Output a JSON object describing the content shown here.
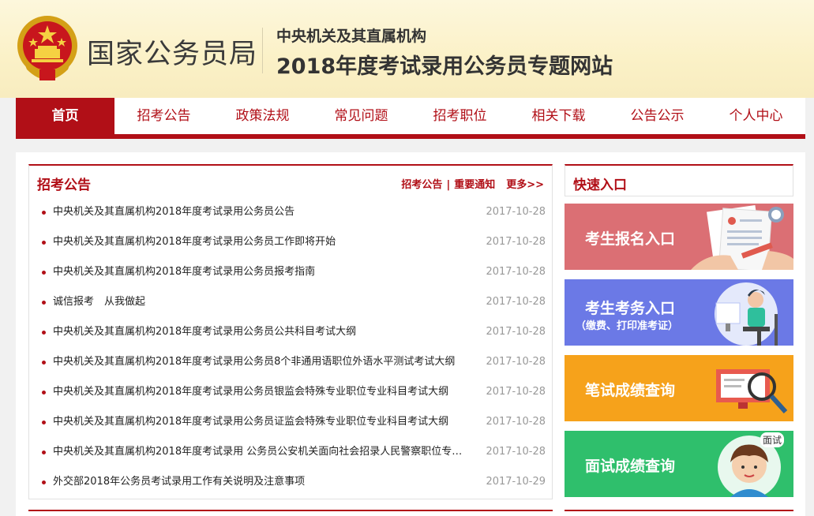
{
  "header": {
    "org_name": "国家公务员局",
    "subtitle_line1": "中央机关及其直属机构",
    "subtitle_line2": "2018年度考试录用公务员专题网站",
    "emblem_icon": "national-emblem-icon"
  },
  "nav": {
    "items": [
      {
        "label": "首页",
        "active": true
      },
      {
        "label": "招考公告"
      },
      {
        "label": "政策法规"
      },
      {
        "label": "常见问题"
      },
      {
        "label": "招考职位"
      },
      {
        "label": "相关下载"
      },
      {
        "label": "公告公示"
      },
      {
        "label": "个人中心"
      }
    ]
  },
  "notices": {
    "title": "招考公告",
    "link1": "招考公告",
    "separator": "|",
    "link2": "重要通知",
    "more": "更多>>",
    "items": [
      {
        "title": "中央机关及其直属机构2018年度考试录用公务员公告",
        "date": "2017-10-28"
      },
      {
        "title": "中央机关及其直属机构2018年度考试录用公务员工作即将开始",
        "date": "2017-10-28"
      },
      {
        "title": "中央机关及其直属机构2018年度考试录用公务员报考指南",
        "date": "2017-10-28"
      },
      {
        "title": "诚信报考　从我做起",
        "date": "2017-10-28"
      },
      {
        "title": "中央机关及其直属机构2018年度考试录用公务员公共科目考试大纲",
        "date": "2017-10-28"
      },
      {
        "title": "中央机关及其直属机构2018年度考试录用公务员8个非通用语职位外语水平测试考试大纲",
        "date": "2017-10-28"
      },
      {
        "title": "中央机关及其直属机构2018年度考试录用公务员银监会特殊专业职位专业科目考试大纲",
        "date": "2017-10-28"
      },
      {
        "title": "中央机关及其直属机构2018年度考试录用公务员证监会特殊专业职位专业科目考试大纲",
        "date": "2017-10-28"
      },
      {
        "title": "中央机关及其直属机构2018年度考试录用 公务员公安机关面向社会招录人民警察职位专业...",
        "date": "2017-10-28"
      },
      {
        "title": "外交部2018年公务员考试录用工作有关说明及注意事项",
        "date": "2017-10-29"
      }
    ]
  },
  "quick": {
    "title": "快速入口",
    "cards": [
      {
        "label": "考生报名入口",
        "color": "#db6f74",
        "icon": "registration-form-icon"
      },
      {
        "label": "考生考务入口",
        "sub": "（缴费、打印准考证）",
        "color": "#6b79e6",
        "icon": "student-at-computer-icon"
      },
      {
        "label": "笔试成绩查询",
        "color": "#f6a21b",
        "icon": "magnifier-on-screen-icon"
      },
      {
        "label": "面试成绩查询",
        "color": "#2fbf6c",
        "icon": "interview-person-icon",
        "badge": "面试"
      }
    ]
  },
  "colors": {
    "brand_red": "#b10f17",
    "header_bg": "#fbf1c7"
  }
}
